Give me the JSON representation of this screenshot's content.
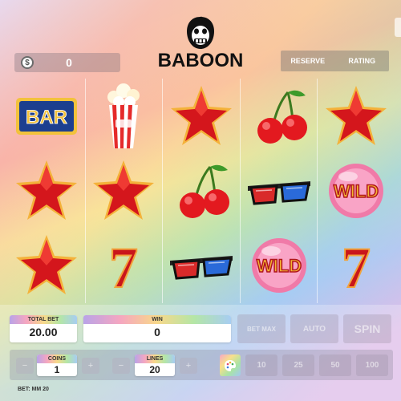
{
  "header": {
    "balance_icon": "dollar-coin-icon",
    "balance_symbol": "$",
    "balance_value": "0",
    "logo_text": "BABOON",
    "tabs": [
      "RESERVE",
      "RATING"
    ]
  },
  "reels": [
    [
      "bar",
      "star",
      "star"
    ],
    [
      "popcorn",
      "star",
      "seven"
    ],
    [
      "star",
      "cherries",
      "glasses"
    ],
    [
      "cherries",
      "glasses",
      "wild"
    ],
    [
      "star",
      "wild",
      "seven"
    ]
  ],
  "symbols": {
    "bar": "BAR",
    "wild": "WILD",
    "seven": "7"
  },
  "bet_panel": {
    "total_bet_label": "TOTAL BET",
    "total_bet_value": "20.00",
    "win_label": "WIN",
    "win_value": "0",
    "bet_max_label": "BET MAX",
    "auto_label": "AUTO",
    "spin_label": "SPIN",
    "coins_label": "COINS",
    "coins_value": "1",
    "lines_label": "LINES",
    "lines_value": "20",
    "minus_symbol": "−",
    "plus_symbol": "+",
    "quick_lines": [
      "10",
      "25",
      "50",
      "100"
    ],
    "footer": "BET: MM 20"
  },
  "colors": {
    "star_red": "#d4161c",
    "star_rim": "#f4b23a",
    "cherry_red": "#e3191f",
    "bar_blue": "#1c3f8f",
    "bar_gold": "#f2c23c"
  }
}
